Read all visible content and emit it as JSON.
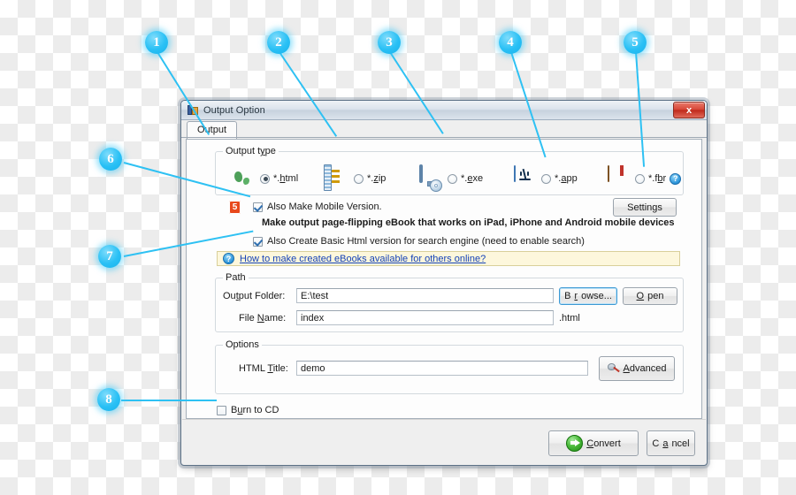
{
  "window": {
    "title": "Output Option",
    "icon": "app-icon",
    "close_label": "x",
    "tab": "Output"
  },
  "output_type": {
    "legend": "Output type",
    "legend_underline": "t",
    "options": [
      {
        "id": "html",
        "label": "*.html",
        "accesskey": "h",
        "icon": "globe-icon",
        "selected": true
      },
      {
        "id": "zip",
        "label": "*.zip",
        "accesskey": "z",
        "icon": "zip-icon",
        "selected": false
      },
      {
        "id": "exe",
        "label": "*.exe",
        "accesskey": "e",
        "icon": "monitor-cd-icon",
        "selected": false
      },
      {
        "id": "app",
        "label": "*.app",
        "accesskey": "a",
        "icon": "mac-finder-icon",
        "selected": false
      },
      {
        "id": "fbr",
        "label": "*.fbr",
        "accesskey": "b",
        "icon": "book-icon",
        "selected": false
      }
    ],
    "help_icon": "?"
  },
  "mobile": {
    "html5_badge": "5",
    "checkbox_label": "Also Make Mobile Version.",
    "checked": true,
    "description": "Make output page-flipping eBook that works on iPad, iPhone and Android mobile devices",
    "settings_button": "Settings"
  },
  "basic_html": {
    "checkbox_label": "Also Create Basic Html version for search engine (need to enable search)",
    "checked": true
  },
  "info": {
    "icon": "question-icon",
    "link": "How to make created eBooks available for others online?"
  },
  "path": {
    "legend": "Path",
    "output_folder_label": "Output Folder:",
    "output_folder_value": "E:\\test",
    "browse_button": "Browse...",
    "open_button": "Open",
    "file_name_label": "File Name:",
    "file_name_value": "index",
    "file_extension": ".html"
  },
  "options": {
    "legend": "Options",
    "html_title_label": "HTML Title:",
    "html_title_value": "demo",
    "advanced_button": "Advanced"
  },
  "burn": {
    "label": "Burn to CD",
    "checked": false
  },
  "footer": {
    "convert_button": "Convert",
    "cancel_button": "Cancel"
  },
  "callouts": [
    {
      "n": "1"
    },
    {
      "n": "2"
    },
    {
      "n": "3"
    },
    {
      "n": "4"
    },
    {
      "n": "5"
    },
    {
      "n": "6"
    },
    {
      "n": "7"
    },
    {
      "n": "8"
    }
  ],
  "colors": {
    "callout": "#29c0f5",
    "link": "#1543b8",
    "info_bg": "#fdf7dc",
    "close_red": "#d8493a",
    "convert_green": "#4cbb3c",
    "html5_orange": "#e8491c"
  }
}
